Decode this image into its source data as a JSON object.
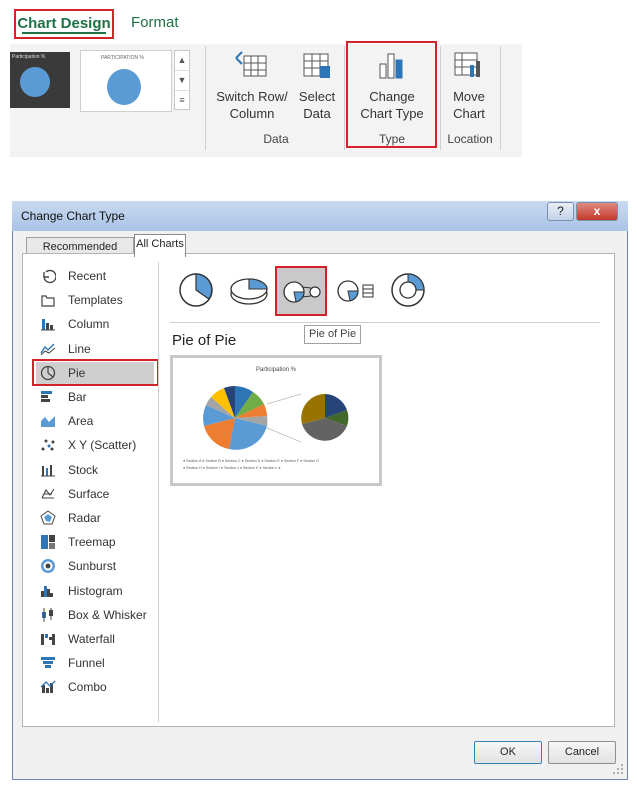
{
  "ribbon": {
    "tabs": {
      "chart_design": "Chart Design",
      "format": "Format"
    },
    "buttons": {
      "switch_row_line1": "Switch Row/",
      "switch_row_line2": "Column",
      "select_line1": "Select",
      "select_line2": "Data",
      "change_line1": "Change",
      "change_line2": "Chart Type",
      "move_line1": "Move",
      "move_line2": "Chart"
    },
    "groups": {
      "data": "Data",
      "type": "Type",
      "location": "Location"
    },
    "thumb_small_title": "Participation %",
    "thumb_small_title2": "PARTICIPATION %"
  },
  "dialog": {
    "title": "Change Chart Type",
    "help_icon": "?",
    "close_icon": "x",
    "tabs": {
      "recommended": "Recommended Charts",
      "all": "All Charts"
    },
    "types": [
      {
        "label": "Recent",
        "icon": "recent-icon"
      },
      {
        "label": "Templates",
        "icon": "templates-icon"
      },
      {
        "label": "Column",
        "icon": "column-icon"
      },
      {
        "label": "Line",
        "icon": "line-icon"
      },
      {
        "label": "Pie",
        "icon": "pie-icon"
      },
      {
        "label": "Bar",
        "icon": "bar-icon"
      },
      {
        "label": "Area",
        "icon": "area-icon"
      },
      {
        "label": "X Y (Scatter)",
        "icon": "scatter-icon"
      },
      {
        "label": "Stock",
        "icon": "stock-icon"
      },
      {
        "label": "Surface",
        "icon": "surface-icon"
      },
      {
        "label": "Radar",
        "icon": "radar-icon"
      },
      {
        "label": "Treemap",
        "icon": "treemap-icon"
      },
      {
        "label": "Sunburst",
        "icon": "sunburst-icon"
      },
      {
        "label": "Histogram",
        "icon": "histogram-icon"
      },
      {
        "label": "Box & Whisker",
        "icon": "box-whisker-icon"
      },
      {
        "label": "Waterfall",
        "icon": "waterfall-icon"
      },
      {
        "label": "Funnel",
        "icon": "funnel-icon"
      },
      {
        "label": "Combo",
        "icon": "combo-icon"
      }
    ],
    "selected_type": "Pie",
    "tooltip": "Pie of Pie",
    "subtype_title": "Pie of Pie",
    "preview": {
      "title": "Participation %",
      "legend_line1": "● Section A  ● Section B  ● Section C  ● Section D  ● Section E  ● Section F  ● Section G",
      "legend_line2": "● Section H  ● Section I  ● Section J  ● Section K  ● Section L  ●"
    },
    "ok": "OK",
    "cancel": "Cancel"
  },
  "colors": {
    "accent_green": "#1e7145",
    "highlight_red": "#d2232a",
    "pie_blue": "#5b9bd5"
  }
}
